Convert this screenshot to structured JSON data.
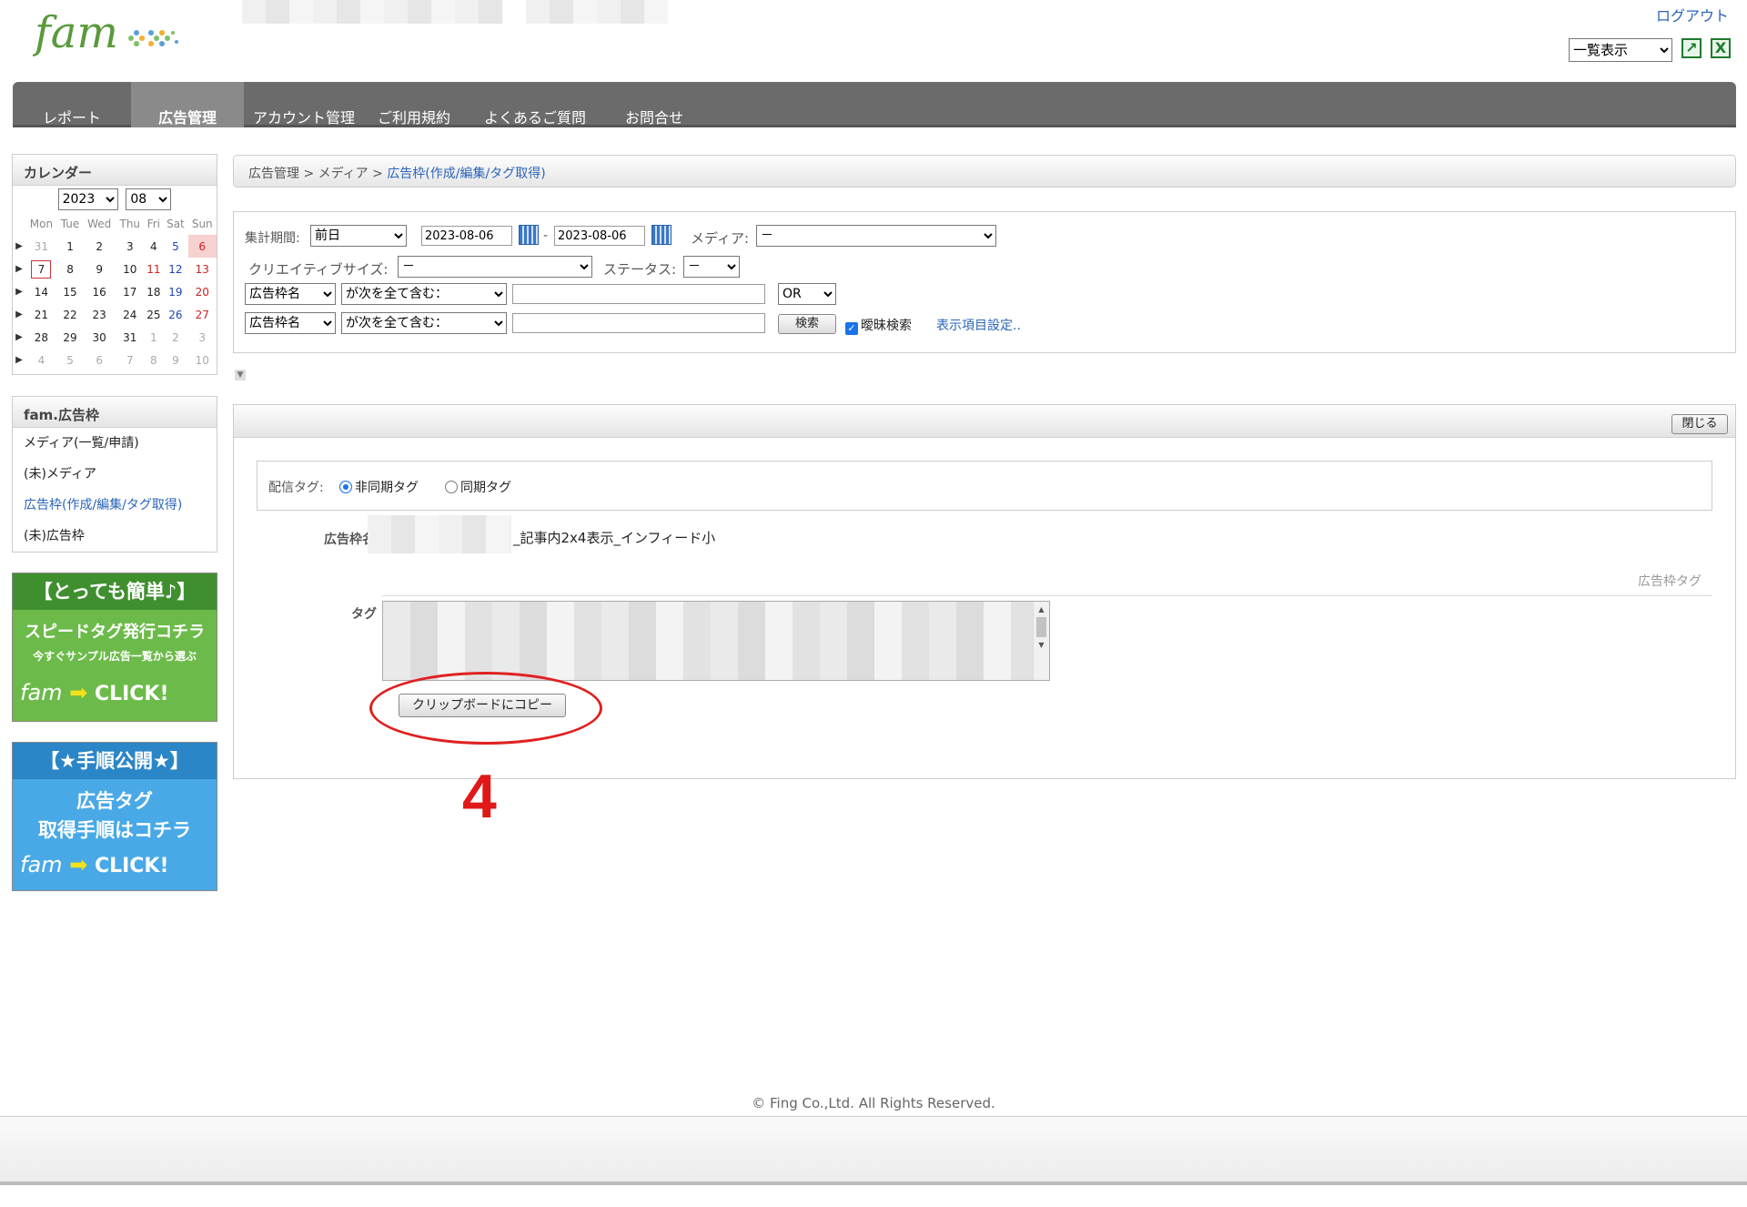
{
  "header": {
    "logo_text": "fam",
    "logout": "ログアウト",
    "view_select": "一覧表示",
    "icon_export": "excel-export-icon",
    "icon_excel": "excel-icon"
  },
  "nav": {
    "items": [
      "レポート",
      "広告管理",
      "アカウント管理",
      "ご利用規約",
      "よくあるご質問",
      "お問合せ"
    ],
    "active_index": 1
  },
  "calendar": {
    "title": "カレンダー",
    "year": "2023",
    "month": "08",
    "weekdays": [
      "Mon",
      "Tue",
      "Wed",
      "Thu",
      "Fri",
      "Sat",
      "Sun"
    ],
    "weeks": [
      [
        "31",
        "1",
        "2",
        "3",
        "4",
        "5",
        "6"
      ],
      [
        "7",
        "8",
        "9",
        "10",
        "11",
        "12",
        "13"
      ],
      [
        "14",
        "15",
        "16",
        "17",
        "18",
        "19",
        "20"
      ],
      [
        "21",
        "22",
        "23",
        "24",
        "25",
        "26",
        "27"
      ],
      [
        "28",
        "29",
        "30",
        "31",
        "1",
        "2",
        "3"
      ],
      [
        "4",
        "5",
        "6",
        "7",
        "8",
        "9",
        "10"
      ]
    ],
    "arrow": "▶"
  },
  "sidemenu": {
    "title": "fam.広告枠",
    "items": [
      "メディア(一覧/申請)",
      "(未)メディア",
      "広告枠(作成/編集/タグ取得)",
      "(未)広告枠"
    ]
  },
  "banners": [
    {
      "line1": "【とっても簡単♪】",
      "line2": "スピードタグ発行コチラ",
      "line3": "今すぐサンプル広告一覧から選ぶ",
      "cta": "CLICK!",
      "brand": "fam"
    },
    {
      "line1": "【★手順公開★】",
      "line2": "広告タグ",
      "line3": "取得手順はコチラ",
      "cta": "CLICK!",
      "brand": "fam"
    }
  ],
  "breadcrumb": {
    "items": [
      "広告管理",
      "メディア",
      "広告枠(作成/編集/タグ取得)"
    ],
    "sep": ">"
  },
  "filter": {
    "period_label": "集計期間:",
    "period_value": "前日",
    "date_from": "2023-08-06",
    "date_sep": "-",
    "date_to": "2023-08-06",
    "media_label": "メディア:",
    "media_value": "－",
    "creative_size_label": "クリエイティブサイズ:",
    "creative_size_value": "－",
    "status_label": "ステータス:",
    "status_value": "－",
    "field1": "広告枠名",
    "cond1": "が次を全て含む：",
    "logic": "OR",
    "field2": "広告枠名",
    "cond2": "が次を全て含む：",
    "search_button": "検索",
    "fuzzy_label": "曖昧検索",
    "display_settings": "表示項目設定.."
  },
  "result": {
    "close_button": "閉じる",
    "delivery_label": "配信タグ:",
    "async_label": "非同期タグ",
    "sync_label": "同期タグ",
    "adslot_label": "広告枠名",
    "adslot_value": "_記事内2x4表示_インフィード小",
    "section_label": "広告枠タグ",
    "tag_label": "タグ",
    "copy_button": "クリップボードにコピー"
  },
  "annotation": {
    "step": "4",
    "color": "#e01818"
  },
  "footer": {
    "copyright": "© Fing Co.,Ltd. All Rights Reserved."
  },
  "colors": {
    "nav_bg": "#6b6b6b",
    "link": "#2a64b8",
    "banner1": "#3f8f2f",
    "banner2": "#3a9ad9"
  }
}
